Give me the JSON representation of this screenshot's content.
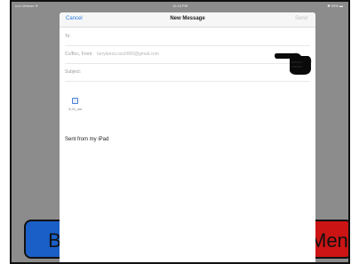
{
  "status_bar": {
    "left": "••••• Verizon ✈",
    "time": "12:19 PM",
    "right": "✱ 99% ▬"
  },
  "background_buttons": {
    "left_label": "Ba",
    "right_label": "Menu"
  },
  "compose": {
    "cancel_label": "Cancel",
    "title": "New Message",
    "send_label": "Send",
    "to_label": "To:",
    "cc_label": "Cc/Bcc, From:",
    "from_value": "larrylanza.oss0000@gmail.com",
    "subject_label": "Subject:",
    "attachment_name": "3-21_sw",
    "signature": "Sent from my iPad"
  },
  "icons": [
    "attachment-file-icon",
    "pointing-hand-icon"
  ],
  "colors": {
    "accent": "#2a7ae2",
    "left_button": "#1a5fc7",
    "right_button": "#cc1414",
    "backdrop": "#8c8c8c"
  }
}
